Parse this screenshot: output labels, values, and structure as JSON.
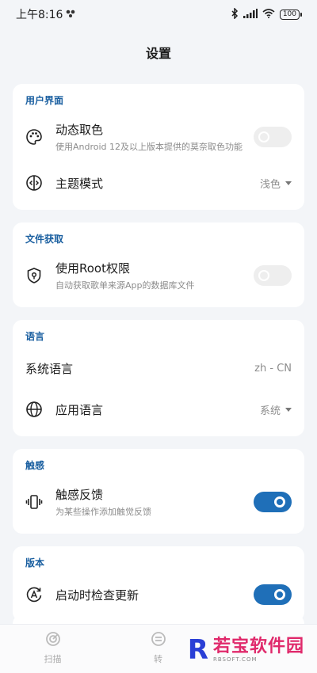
{
  "status_bar": {
    "time": "上午8:16",
    "battery": "100"
  },
  "page_title": "设置",
  "sections": {
    "ui": {
      "label": "用户界面",
      "dynamic_color": {
        "title": "动态取色",
        "subtitle": "使用Android 12及以上版本提供的莫奈取色功能",
        "enabled": false
      },
      "theme_mode": {
        "title": "主题模式",
        "value": "浅色"
      }
    },
    "file": {
      "label": "文件获取",
      "root": {
        "title": "使用Root权限",
        "subtitle": "自动获取歌单来源App的数据库文件",
        "enabled": false
      }
    },
    "language": {
      "label": "语言",
      "system_language": {
        "title": "系统语言",
        "value": "zh - CN"
      },
      "app_language": {
        "title": "应用语言",
        "value": "系统"
      }
    },
    "haptics": {
      "label": "触感",
      "feedback": {
        "title": "触感反馈",
        "subtitle": "为某些操作添加触觉反馈",
        "enabled": true
      }
    },
    "version": {
      "label": "版本",
      "check_update": {
        "title": "启动时检查更新",
        "enabled": true
      }
    }
  },
  "bottom_nav": {
    "items": [
      {
        "label": "扫描",
        "icon": "scan-icon"
      },
      {
        "label": "转",
        "icon": "convert-icon"
      }
    ]
  },
  "watermark": {
    "logo": "R",
    "text": "若宝软件园",
    "sub": "RBSOFT.COM"
  },
  "colors": {
    "accent": "#1f6fb8",
    "section_label": "#1a5fa0",
    "background": "#f3f5f8",
    "card": "#ffffff"
  }
}
